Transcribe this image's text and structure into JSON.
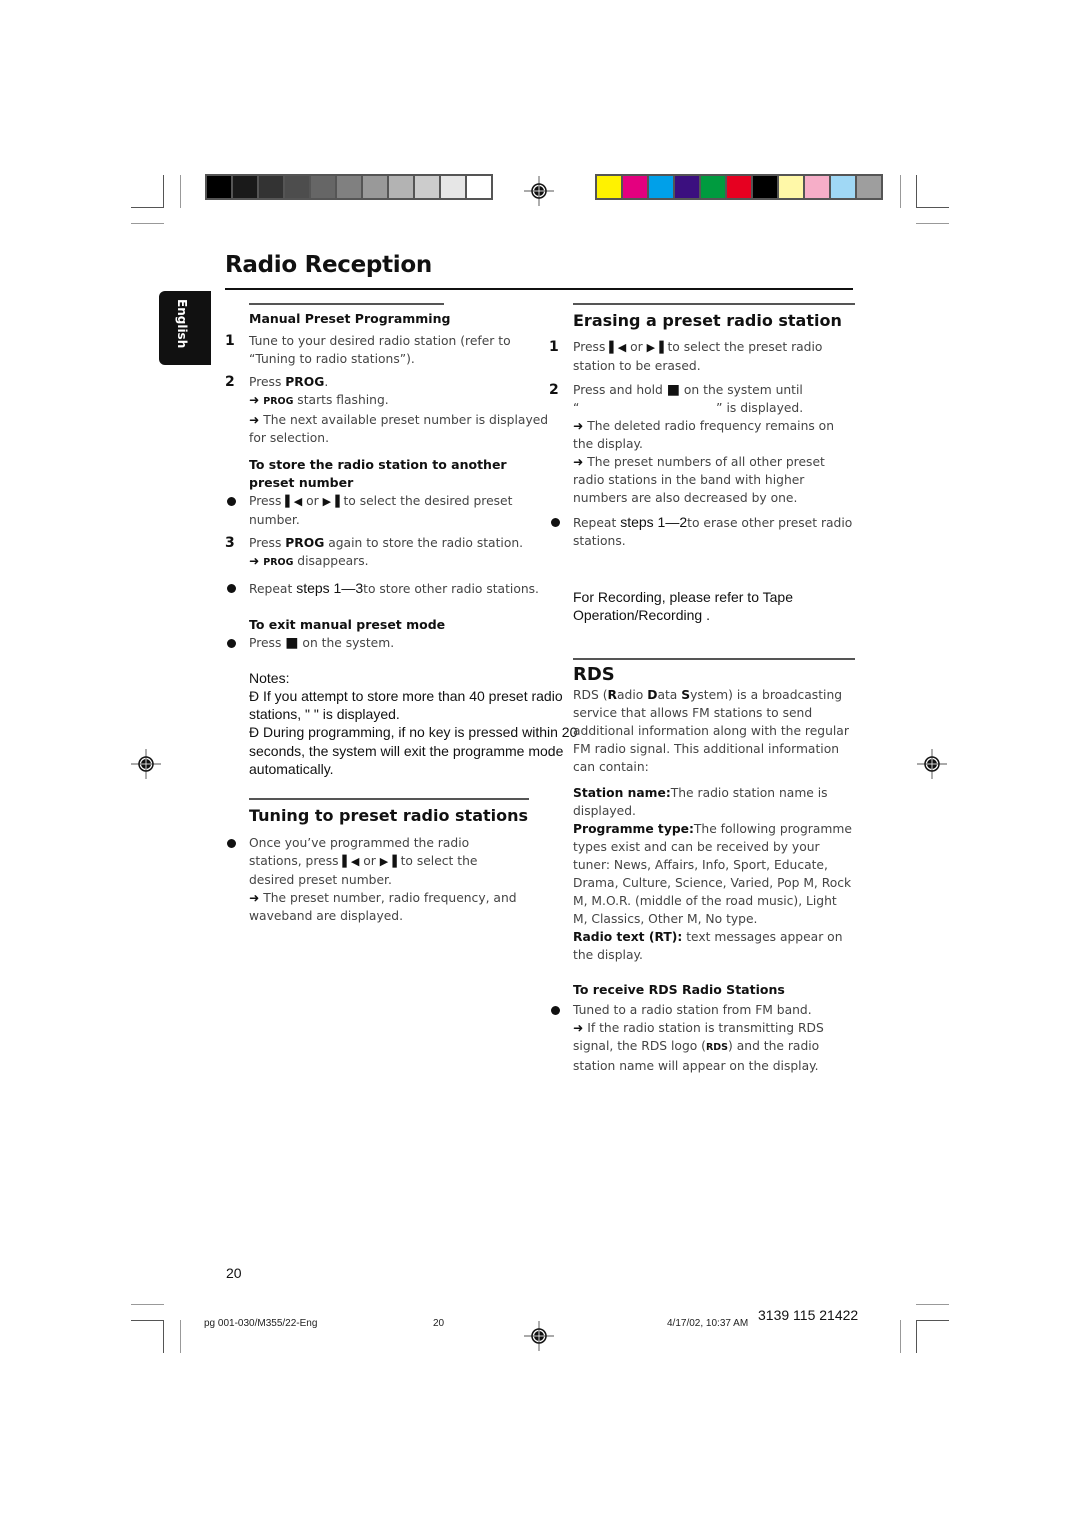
{
  "calibration": {
    "gray_bar": [
      "#000000",
      "#1a1a1a",
      "#333333",
      "#4d4d4d",
      "#666666",
      "#808080",
      "#999999",
      "#b3b3b3",
      "#cccccc",
      "#e6e6e6",
      "#ffffff"
    ],
    "color_bar": [
      "#fff200",
      "#e4007f",
      "#00a0e9",
      "#3b0f7f",
      "#009b3f",
      "#e60020",
      "#000000",
      "#fff8a8",
      "#f6aec8",
      "#a0d8f5",
      "#9e9e9e"
    ]
  },
  "header": {
    "title": "Radio Reception",
    "language_tab": "English"
  },
  "left": {
    "manual": {
      "heading": "Manual Preset Programming",
      "step1_num": "1",
      "step1_text": "Tune to your desired radio station (refer to “Tuning to radio stations”).",
      "step2_num": "2",
      "step2_pre": "Press ",
      "step2_bold": "PROG",
      "step2_post": ".",
      "step2_r1_badge": "PROG",
      "step2_r1_text": " starts flashing.",
      "step2_r2_text": " The next available preset number is displayed for selection.",
      "store_heading": "To store the radio station to another preset number",
      "store_b1_pre": "Press ",
      "store_b1_mid": " or ",
      "store_b1_post": " to select the desired preset number.",
      "step3_num": "3",
      "step3_pre": "Press ",
      "step3_bold": "PROG",
      "step3_post": " again to store the radio station.",
      "step3_r1_badge": "PROG",
      "step3_r1_text": " disappears.",
      "repeat_pre": "Repeat ",
      "repeat_steps": "steps 1—3",
      "repeat_post": "to store other radio stations.",
      "exit_heading": "To exit manual preset mode",
      "exit_pre": "Press ",
      "exit_post": " on the system."
    },
    "notes": {
      "label": "Notes:",
      "n1": "Ð  If you attempt to store more than 40 preset radio stations, \"     \" is displayed.",
      "n2": "Ð  During programming, if no key is pressed within 20 seconds, the system will exit the programme mode automatically."
    },
    "tuning": {
      "heading": "Tuning to preset radio stations",
      "b1_pre": "Once you’ve programmed the radio stations, press ",
      "b1_mid": " or ",
      "b1_post": " to select the desired preset number.",
      "r1_text": " The preset number, radio frequency, and waveband are displayed."
    }
  },
  "right": {
    "erase": {
      "heading": "Erasing a preset radio station",
      "s1_num": "1",
      "s1_pre": "Press ",
      "s1_mid": " or ",
      "s1_post": " to select the preset radio station to be erased.",
      "s2_num": "2",
      "s2_pre": "Press and hold ",
      "s2_post": " on the system until",
      "s2_line2": "“                                   ” is displayed.",
      "r1_text": " The deleted radio frequency remains on the display.",
      "r2_text": " The preset numbers of all other preset radio stations in the band with higher numbers are also decreased by one.",
      "repeat_pre": "Repeat ",
      "repeat_steps": "steps 1—2",
      "repeat_post": "to erase other preset radio stations."
    },
    "recording_note": "For Recording, please refer to  Tape Operation/Recording .",
    "rds": {
      "heading": "RDS",
      "intro_1": "RDS (",
      "intro_R": "R",
      "intro_2": "adio ",
      "intro_D": "D",
      "intro_3": "ata ",
      "intro_S": "S",
      "intro_4": "ystem) is a broadcasting service that allows FM stations to send additional information along with the regular FM radio signal. This additional information can contain:",
      "station_label": "Station name:",
      "station_text": "The radio station name is displayed.",
      "ptype_label": "Programme type:",
      "ptype_text": "The following programme types exist and can be received by your tuner: News, Affairs, Info, Sport, Educate, Drama, Culture, Science, Varied, Pop M, Rock M, M.O.R. (middle of the road music), Light M, Classics, Other M, No type.",
      "rt_label": "Radio text (RT):",
      "rt_text": " text messages appear on the display.",
      "receive_heading": "To receive RDS Radio Stations",
      "receive_b1": "Tuned to a radio station from FM band.",
      "receive_r1_pre": " If the radio station is transmitting RDS signal, the RDS logo (",
      "receive_r1_badge": "RDS",
      "receive_r1_post": ") and the radio station name will appear on the display."
    }
  },
  "footer": {
    "page_number": "20",
    "file_name": "pg 001-030/M355/22-Eng",
    "file_page": "20",
    "timestamp": "4/17/02, 10:37 AM",
    "code": "3139 115 21422"
  },
  "icons": {
    "arrow": "➜",
    "prev": "⏮",
    "next": "⏭",
    "stop": "■"
  }
}
